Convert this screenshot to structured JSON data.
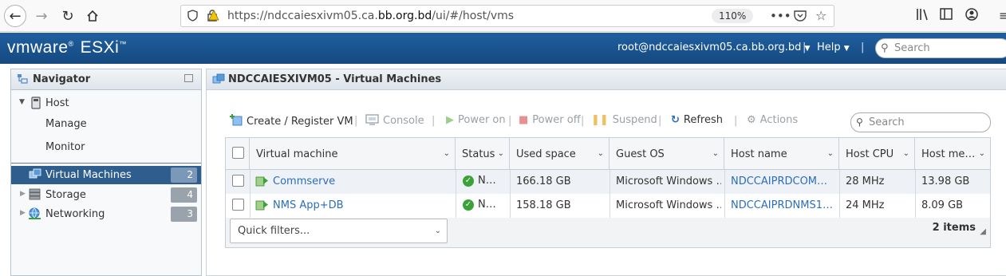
{
  "browser": {
    "url_prefix": "https://ndccaiesxivm05.ca.",
    "url_domain": "bb.org.bd",
    "url_suffix": "/ui/#/host/vms",
    "zoom": "110%"
  },
  "header": {
    "brand_vm": "vmware",
    "brand_product": "ESXi",
    "user": "root@ndccaiesxivm05.ca.bb.org.bd",
    "help": "Help",
    "search_placeholder": "Search"
  },
  "navigator": {
    "title": "Navigator",
    "host": "Host",
    "manage": "Manage",
    "monitor": "Monitor",
    "items": [
      {
        "label": "Virtual Machines",
        "count": "2"
      },
      {
        "label": "Storage",
        "count": "4"
      },
      {
        "label": "Networking",
        "count": "3"
      }
    ]
  },
  "main": {
    "title": "NDCCAIESXIVM05 - Virtual Machines",
    "toolbar": {
      "create": "Create / Register VM",
      "console": "Console",
      "power_on": "Power on",
      "power_off": "Power off",
      "suspend": "Suspend",
      "refresh": "Refresh",
      "actions": "Actions"
    },
    "search_placeholder": "Search",
    "columns": [
      "Virtual machine",
      "Status",
      "Used space",
      "Guest OS",
      "Host name",
      "Host CPU",
      "Host me…"
    ],
    "rows": [
      {
        "name": "Commserve",
        "status": "N…",
        "used": "166.18 GB",
        "os": "Microsoft Windows …",
        "host": "NDCCAIPRDCOM…",
        "cpu": "28 MHz",
        "mem": "13.98 GB"
      },
      {
        "name": "NMS App+DB",
        "status": "N…",
        "used": "158.18 GB",
        "os": "Microsoft Windows …",
        "host": "NDCCAIPRDNMS1…",
        "cpu": "24 MHz",
        "mem": "8.09 GB"
      }
    ],
    "quick_filters": "Quick filters...",
    "items_count": "2 items"
  }
}
